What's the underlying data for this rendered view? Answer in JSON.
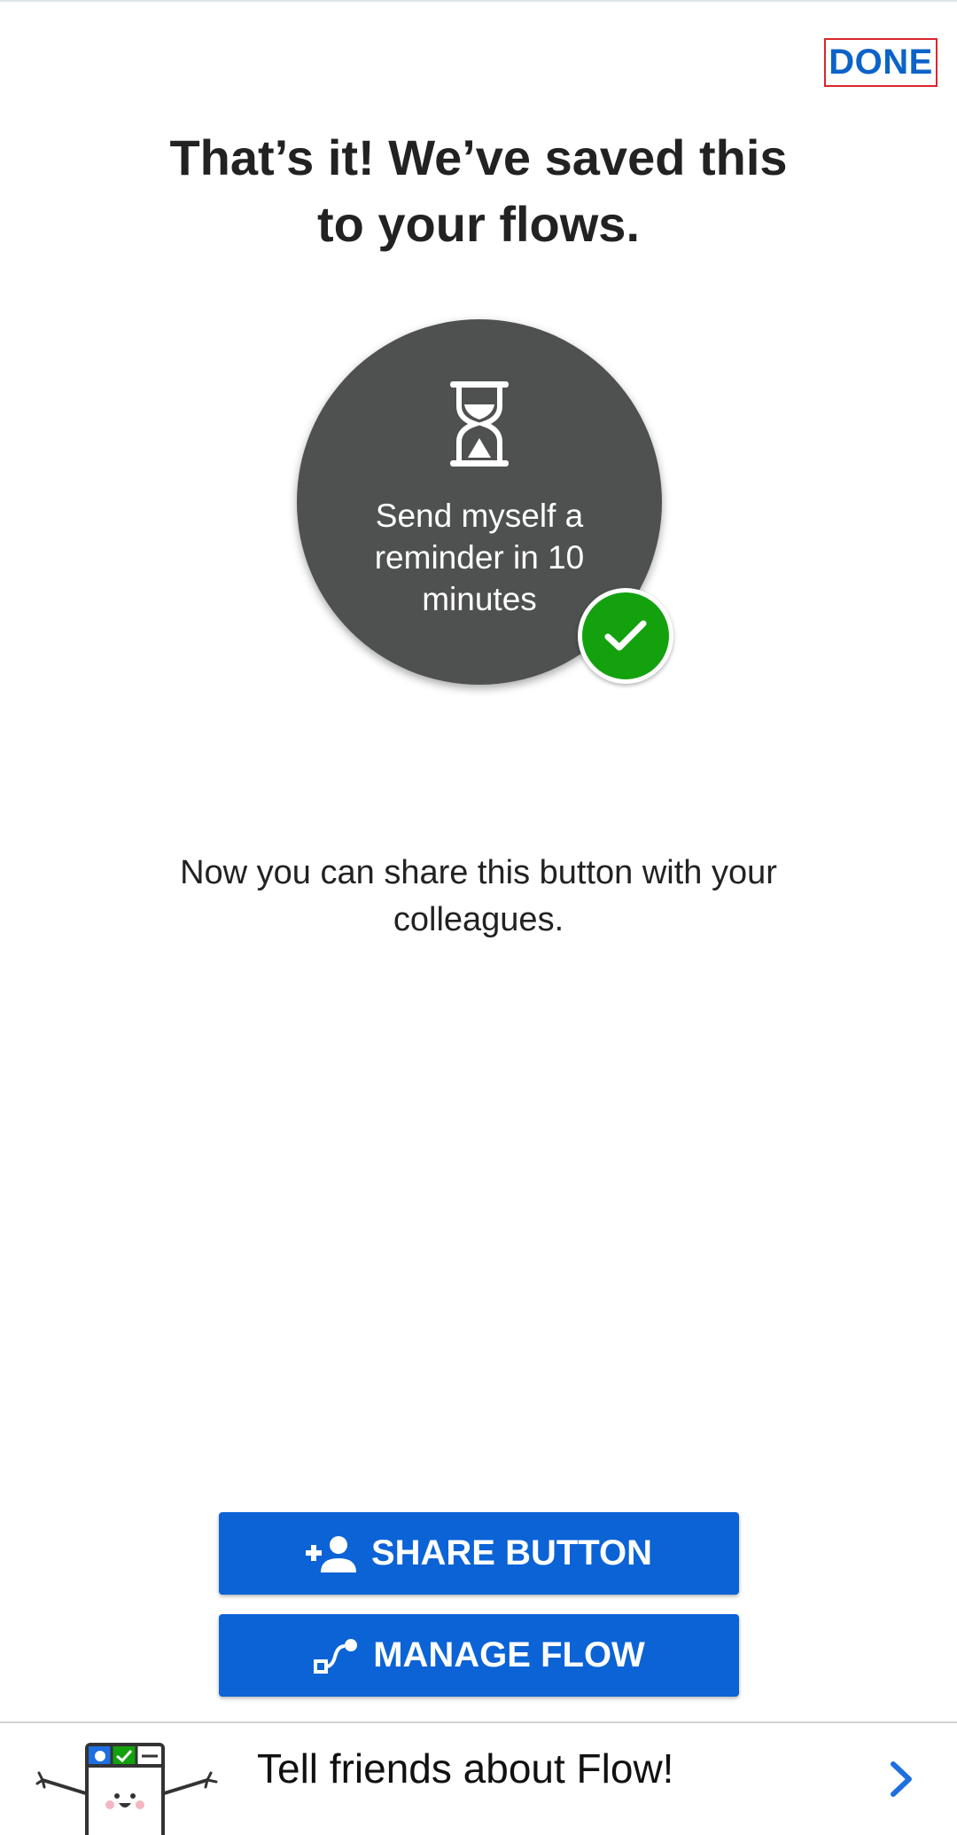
{
  "header": {
    "done_label": "DONE"
  },
  "confirmation": {
    "title_line1": "That’s it! We’ve saved this",
    "title_line2": "to your flows."
  },
  "flow_card": {
    "icon": "hourglass-icon",
    "label_line1": "Send myself a",
    "label_line2": "reminder in 10",
    "label_line3": "minutes",
    "status_icon": "checkmark-icon"
  },
  "message": {
    "line1": "Now you can share this button with your",
    "line2": "colleagues."
  },
  "actions": {
    "share_label": "SHARE BUTTON",
    "share_icon": "add-person-icon",
    "manage_label": "MANAGE FLOW",
    "manage_icon": "flow-icon"
  },
  "banner": {
    "text": "Tell friends about Flow!",
    "icon": "chevron-right-icon"
  },
  "colors": {
    "accent_blue": "#0b63d6",
    "success_green": "#13a10e",
    "card_gray": "#4f5150",
    "highlight_red": "#d9262c"
  }
}
